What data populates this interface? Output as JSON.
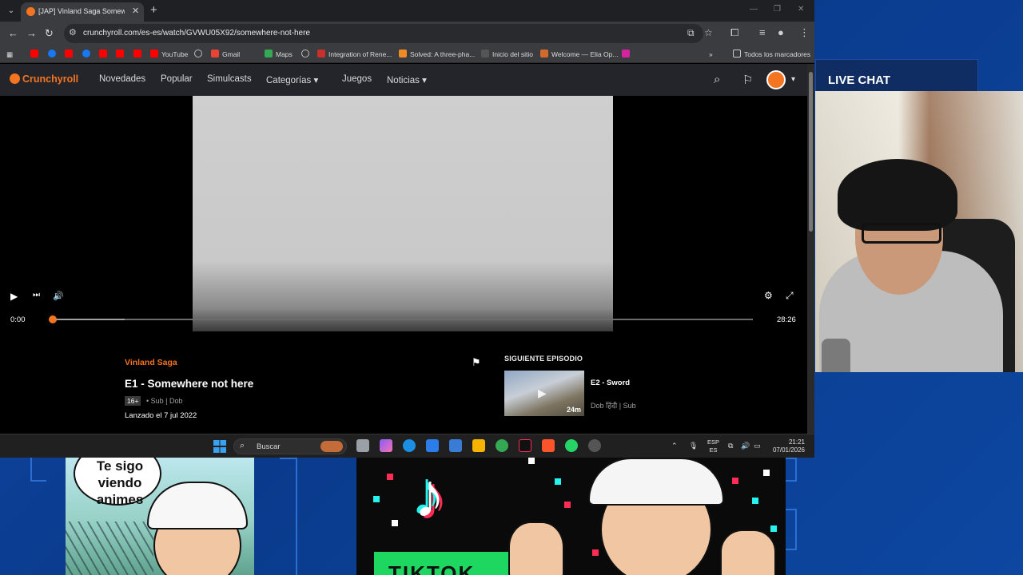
{
  "browser": {
    "tab_title": "[JAP] Vinland Saga Somewhere not here",
    "url": "crunchyroll.com/es-es/watch/GVWU05X92/somewhere-not-here",
    "bookmarks": [
      {
        "label": "",
        "icon": "youtube-icon"
      },
      {
        "label": "",
        "icon": "facebook-icon"
      },
      {
        "label": "",
        "icon": "youtube-icon"
      },
      {
        "label": "",
        "icon": "facebook-icon"
      },
      {
        "label": "",
        "icon": "youtube-icon"
      },
      {
        "label": "",
        "icon": "youtube-icon"
      },
      {
        "label": "YouTube",
        "icon": "youtube-icon"
      },
      {
        "label": "",
        "icon": "globe-icon"
      },
      {
        "label": "Gmail",
        "icon": "gmail-icon"
      },
      {
        "label": "Maps",
        "icon": "maps-icon"
      },
      {
        "label": "",
        "icon": "globe-icon"
      },
      {
        "label": "Integration of Rene...",
        "icon": "sn-icon"
      },
      {
        "label": "Solved: A three-pha...",
        "icon": "chegg-icon"
      },
      {
        "label": "Inicio del sitio",
        "icon": "site-icon"
      },
      {
        "label": "Welcome — Elia Op...",
        "icon": "elia-icon"
      },
      {
        "label": "",
        "icon": "instagram-icon"
      }
    ],
    "all_bookmarks": "Todos los marcadores"
  },
  "crunchyroll": {
    "logo": "Crunchyroll",
    "nav": [
      "Novedades",
      "Popular",
      "Simulcasts",
      "Categorías",
      "Juegos",
      "Noticias"
    ],
    "player": {
      "current_time": "0:00",
      "duration": "28:26",
      "progress_fraction": 0.0
    },
    "episode": {
      "series": "Vinland Saga",
      "title": "E1 - Somewhere not here",
      "rating": "16+",
      "audio": "• Sub | Dob",
      "released": "Lanzado el 7 jul 2022"
    },
    "next": {
      "heading": "SIGUIENTE EPISODIO",
      "title": "E2 - Sword",
      "audio": "Dob हिंदी | Sub",
      "duration": "24m"
    }
  },
  "taskbar": {
    "search": "Buscar",
    "lang_top": "ESP",
    "lang_bottom": "ES",
    "time": "21:21",
    "date": "07/01/2026"
  },
  "overlay": {
    "live_chat": "LIVE CHAT",
    "comic_text": "Te sigo viendo animes",
    "promo_text": "TIKTOK"
  },
  "colors": {
    "crunchyroll_orange": "#f47521",
    "tiktok_cyan": "#25f4ee",
    "tiktok_red": "#fe2c55"
  }
}
